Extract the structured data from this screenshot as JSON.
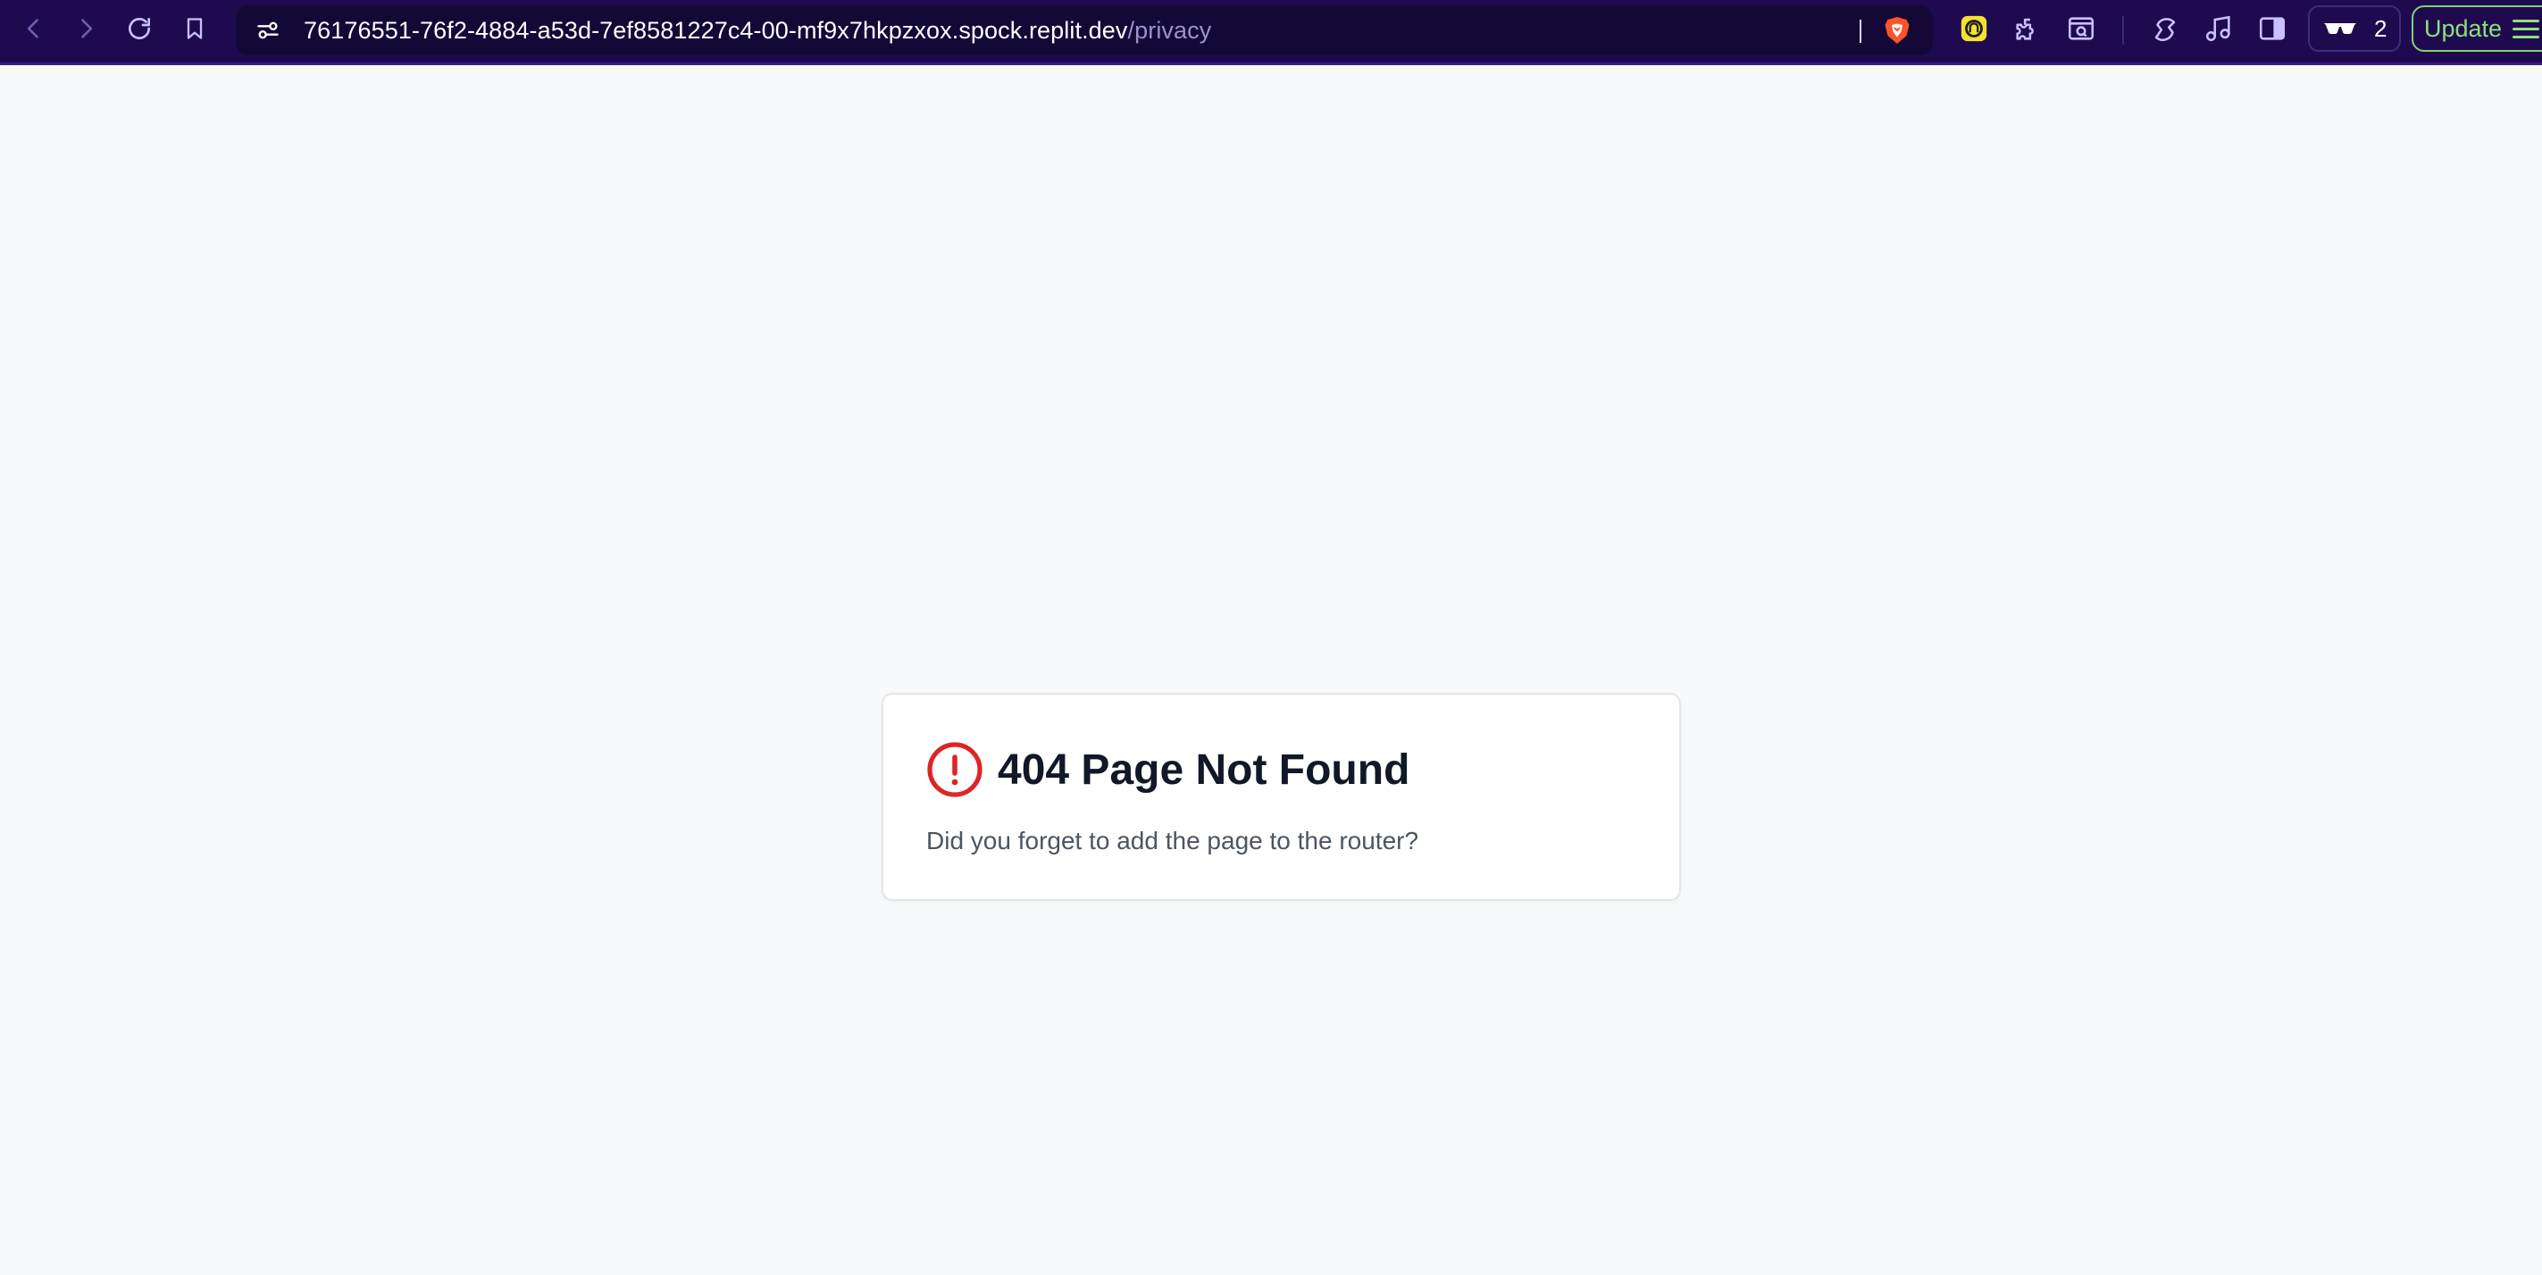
{
  "browser": {
    "url_host": "76176551-76f2-4884-a53d-7ef8581227c4-00-mf9x7hkpzxox.spock.replit.dev",
    "url_path": "/privacy",
    "tab_count": "2",
    "update_label": "Update",
    "icons": {
      "back": "chevron-left-icon",
      "forward": "chevron-right-icon",
      "reload": "reload-icon",
      "bookmark": "bookmark-icon",
      "site_settings": "site-settings-icon",
      "brave": "brave-shields-icon",
      "extension_1": "yellow-extension-icon",
      "extensions": "puzzle-icon",
      "screenshot": "capture-icon",
      "leo": "leo-ai-icon",
      "music": "music-icon",
      "sidebar": "sidebar-icon",
      "private": "sunglasses-icon",
      "menu": "hamburger-menu-icon"
    },
    "colors": {
      "toolbar_bg": "#1f0a4f",
      "urlbar_bg": "#140837",
      "update_green": "#8ee07a"
    }
  },
  "page": {
    "title": "404 Page Not Found",
    "description": "Did you forget to add the page to the router?",
    "icon": "alert-circle-icon",
    "colors": {
      "background": "#f8f9fb",
      "icon_red": "#dc2626",
      "title": "#111827",
      "text": "#4b5563"
    }
  }
}
